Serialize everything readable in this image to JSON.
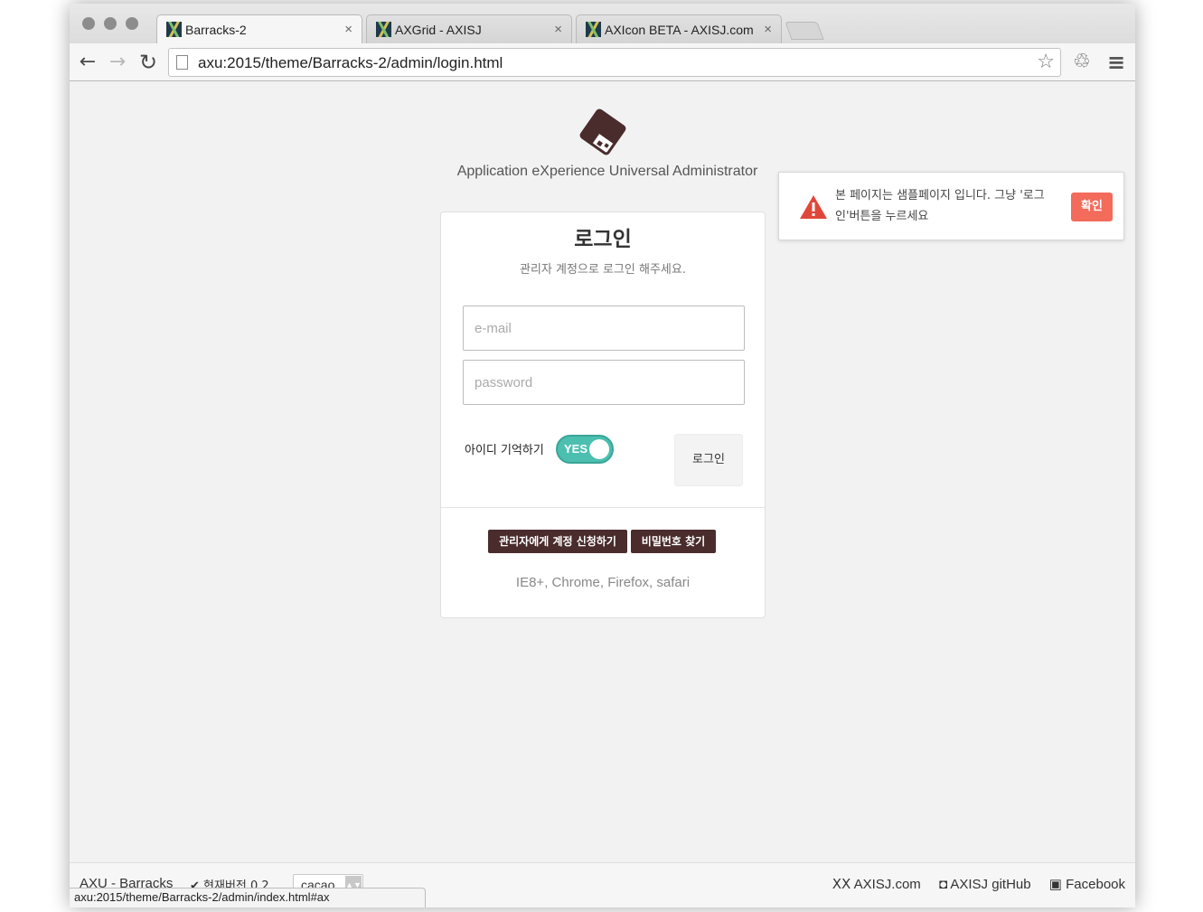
{
  "browser": {
    "tabs": [
      {
        "title": "Barracks-2",
        "close": "×"
      },
      {
        "title": "AXGrid - AXISJ",
        "close": "×"
      },
      {
        "title": "AXIcon BETA - AXISJ.com",
        "close": "×"
      }
    ],
    "nav": {
      "back_icon": "←",
      "forward_icon": "→",
      "reload_icon": "↻"
    },
    "url": "axu:2015/theme/Barracks-2/admin/login.html",
    "star_icon": "☆",
    "extension_icon": "♲",
    "menu_icon": "≡"
  },
  "header": {
    "subtitle": "Application eXperience Universal Administrator"
  },
  "login": {
    "title": "로그인",
    "subtitle": "관리자 계정으로 로그인 해주세요.",
    "email_placeholder": "e-mail",
    "password_placeholder": "password",
    "remember_label": "아이디 기억하기",
    "toggle_text": "YES",
    "submit_label": "로그인",
    "request_account_label": "관리자에게 계정 신청하기",
    "find_password_label": "비밀번호 찾기",
    "supported_browsers": "IE8+, Chrome, Firefox, safari"
  },
  "alert": {
    "message": "본 페이지는 샘플페이지 입니다. 그냥 '로그인'버튼을 누르세요",
    "confirm_label": "확인"
  },
  "footer": {
    "brand": "AXU - Barracks",
    "version_label": "현재버전 0.2",
    "theme_select_value": "cacao",
    "links": [
      "AXISJ.com",
      "AXISJ gitHub",
      "Facebook"
    ]
  },
  "status_bar": {
    "hover_url": "axu:2015/theme/Barracks-2/admin/index.html#ax"
  },
  "colors": {
    "toggle_on": "#4cbfb0",
    "dark_button": "#4a2c2c",
    "confirm_button": "#f26b5b",
    "warning": "#e0473a"
  }
}
